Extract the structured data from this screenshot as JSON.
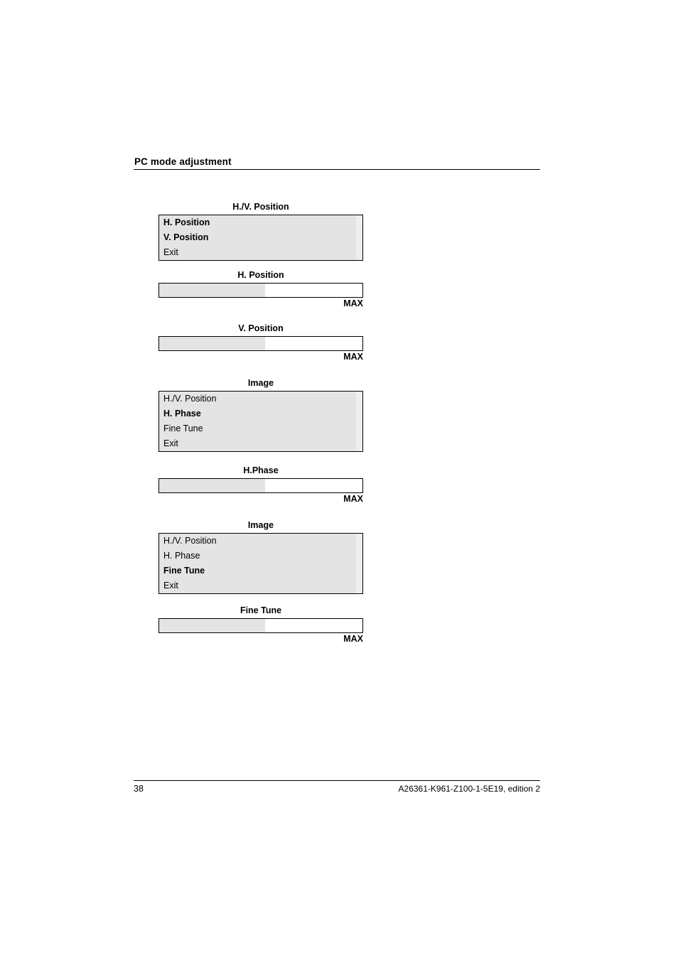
{
  "header": {
    "title": "PC mode adjustment"
  },
  "figures": [
    {
      "kind": "menu",
      "caption": "H./V. Position",
      "items": [
        {
          "label": "H. Position",
          "bold": true
        },
        {
          "label": "V. Position",
          "bold": true
        },
        {
          "label": "Exit",
          "bold": false
        }
      ]
    },
    {
      "kind": "bar",
      "caption": "H. Position",
      "fill_percent": 52,
      "max_label": "MAX"
    },
    {
      "kind": "bar",
      "caption": "V. Position",
      "fill_percent": 52,
      "max_label": "MAX"
    },
    {
      "kind": "menu",
      "caption": "Image",
      "items": [
        {
          "label": "H./V. Position",
          "bold": false
        },
        {
          "label": "H. Phase",
          "bold": true
        },
        {
          "label": "Fine Tune",
          "bold": false
        },
        {
          "label": "Exit",
          "bold": false
        }
      ]
    },
    {
      "kind": "bar",
      "caption": "H.Phase",
      "fill_percent": 52,
      "max_label": "MAX"
    },
    {
      "kind": "menu",
      "caption": "Image",
      "items": [
        {
          "label": "H./V. Position",
          "bold": false
        },
        {
          "label": "H. Phase",
          "bold": false
        },
        {
          "label": "Fine Tune",
          "bold": true
        },
        {
          "label": "Exit",
          "bold": false
        }
      ]
    },
    {
      "kind": "bar",
      "caption": "Fine Tune",
      "fill_percent": 52,
      "max_label": "MAX"
    }
  ],
  "footer": {
    "page_number": "38",
    "document_code": "A26361-K961-Z100-1-5E19, edition 2"
  },
  "colors": {
    "menu_fill": "#e4e4e4",
    "bar_fill": "#e4e4e4",
    "rule": "#000000",
    "page_background": "#ffffff"
  }
}
